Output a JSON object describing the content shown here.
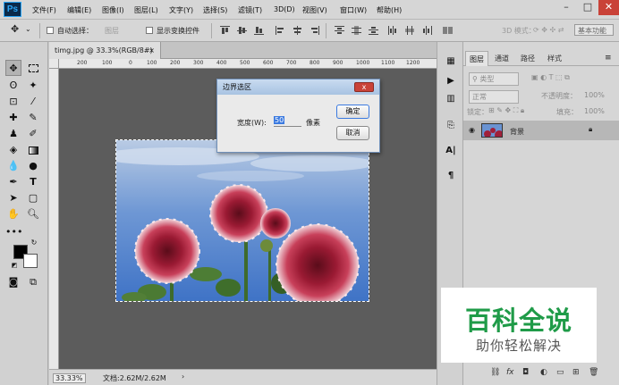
{
  "app": {
    "logo": "Ps"
  },
  "menu": [
    "文件(F)",
    "编辑(E)",
    "图像(I)",
    "图层(L)",
    "文字(Y)",
    "选择(S)",
    "滤镜(T)",
    "3D(D)",
    "视图(V)",
    "窗口(W)",
    "帮助(H)"
  ],
  "window_controls": {
    "minimize": "–",
    "maximize": "□",
    "close": "✕"
  },
  "options": {
    "auto_select_label": "自动选择：",
    "auto_select_target": "图层",
    "show_transform_label": "显示变换控件",
    "mode_3d_label": "3D 模式：",
    "workspace": "基本功能"
  },
  "document": {
    "tab_title": "timg.jpg @ 33.3%(RGB/8#)",
    "tab_close": "×",
    "ruler_ticks": [
      "200",
      "100",
      "0",
      "100",
      "200",
      "300",
      "400",
      "500",
      "600",
      "700",
      "800",
      "900",
      "1000",
      "1100",
      "1200"
    ],
    "zoom": "33.33%",
    "doc_info": "文档:2.62M/2.62M"
  },
  "dialog": {
    "title": "边界选区",
    "close": "x",
    "width_label": "宽度(W):",
    "width_value": "50",
    "unit": "像素",
    "ok_label": "确定",
    "cancel_label": "取消"
  },
  "layers_panel": {
    "tabs": [
      "图层",
      "通道",
      "路径",
      "样式"
    ],
    "kind_filter": "类型",
    "blend_mode": "正常",
    "opacity_label": "不透明度：",
    "opacity_value": "100%",
    "lock_label": "锁定：",
    "fill_label": "填充：",
    "fill_value": "100%",
    "layer_name": "背景"
  },
  "watermark": {
    "title": "百科全说",
    "subtitle": "助你轻松解决"
  },
  "colors": {
    "accent": "#1f9b48",
    "dialog_title": "#b8cfe9",
    "canvas_bg": "#5c5c5c"
  }
}
